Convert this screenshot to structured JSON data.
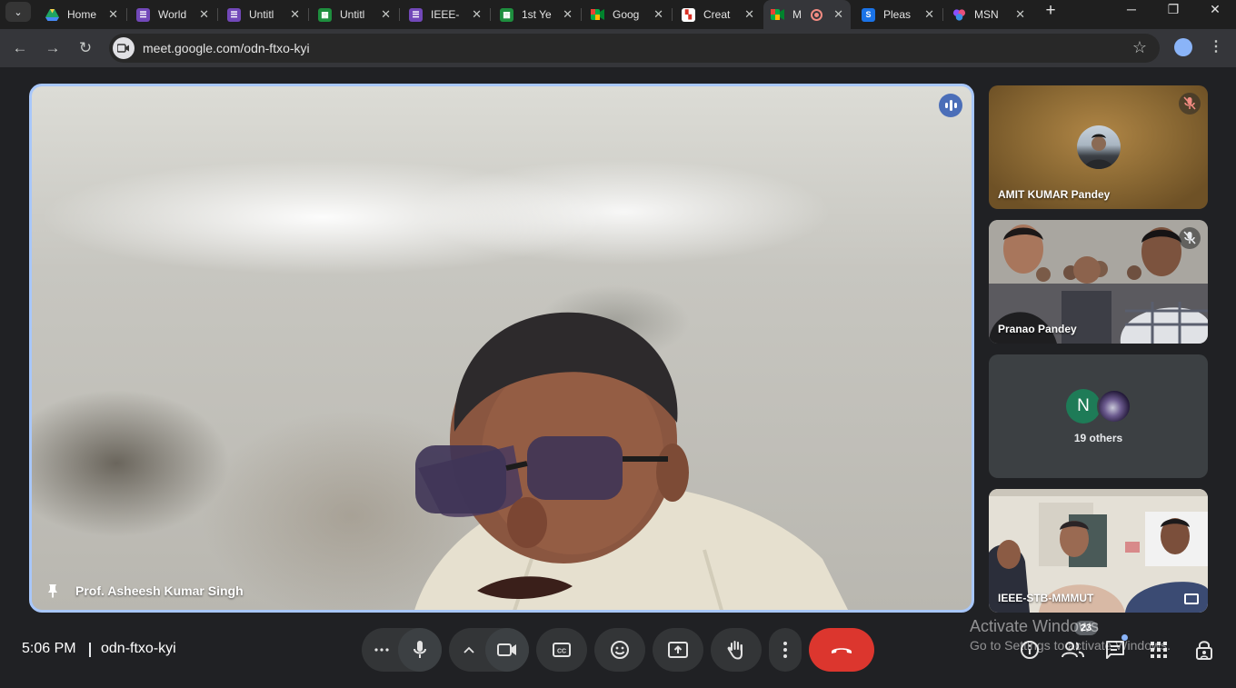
{
  "browser": {
    "tabs": [
      {
        "title": "Home",
        "icon": "drive-icon",
        "color": "#1fa463"
      },
      {
        "title": "World",
        "icon": "forms-icon",
        "color": "#7248b9"
      },
      {
        "title": "Untitl",
        "icon": "forms-icon",
        "color": "#7248b9"
      },
      {
        "title": "Untitl",
        "icon": "sheets-icon",
        "color": "#1e8e3e"
      },
      {
        "title": "IEEE-",
        "icon": "forms-icon",
        "color": "#7248b9"
      },
      {
        "title": "1st Ye",
        "icon": "sheets-icon",
        "color": "#1e8e3e"
      },
      {
        "title": "Goog",
        "icon": "meet-icon",
        "color": "#00832d"
      },
      {
        "title": "Creat",
        "icon": "canvas-icon",
        "color": "#d93025"
      },
      {
        "title": "M",
        "icon": "meet-icon",
        "color": "#00832d",
        "active": true
      },
      {
        "title": "Pleas",
        "icon": "s-icon",
        "color": "#1a73e8"
      },
      {
        "title": "MSN",
        "icon": "msn-icon",
        "color": "#8a4fff"
      }
    ],
    "url": "meet.google.com/odn-ftxo-kyi"
  },
  "meeting": {
    "time": "5:06 PM",
    "code": "odn-ftxo-kyi",
    "main_speaker": "Prof. Asheesh Kumar Singh",
    "participants": [
      {
        "name": "AMIT KUMAR Pandey",
        "muted": true
      },
      {
        "name": "Pranao Pandey",
        "muted": true
      },
      {
        "name": "19 others",
        "avatar_letter": "N"
      },
      {
        "name": "IEEE-STB-MMMUT"
      }
    ],
    "participant_count": "23"
  },
  "windows_watermark": {
    "line1": "Activate Windows",
    "line2": "Go to Settings to activate Windows."
  },
  "colors": {
    "active_border": "#a8c7fa",
    "end_call": "#dc362e",
    "background": "#202124"
  }
}
